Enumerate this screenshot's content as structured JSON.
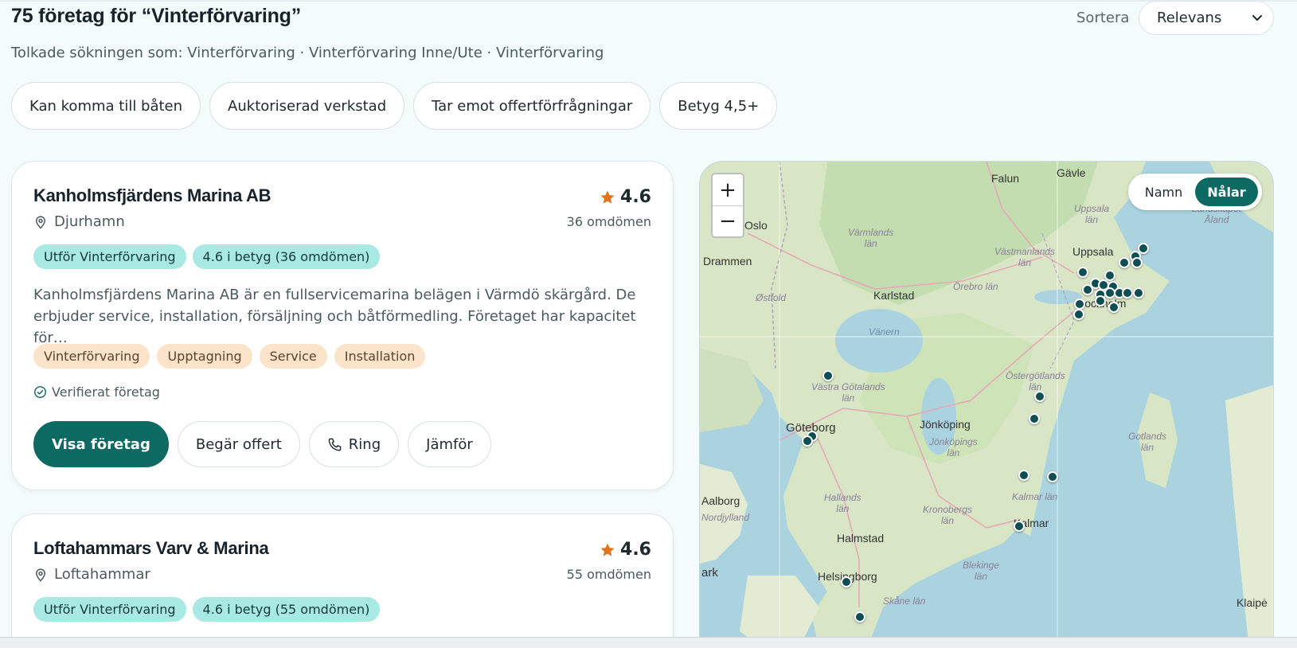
{
  "header": {
    "results_title": "75 företag för “Vinterförvaring”",
    "interpreted_text": "Tolkade sökningen som: Vinterförvaring · Vinterförvaring Inne/Ute · Vinterförvaring",
    "sort_label": "Sortera",
    "sort_value": "Relevans"
  },
  "filters": [
    "Kan komma till båten",
    "Auktoriserad verkstad",
    "Tar emot offertförfrågningar",
    "Betyg 4,5+"
  ],
  "listings": [
    {
      "name": "Kanholmsfjärdens Marina AB",
      "location": "Djurhamn",
      "rating": "4.6",
      "reviews": "36 omdömen",
      "badges": [
        "Utför Vinterförvaring",
        "4.6 i betyg (36 omdömen)"
      ],
      "description": "Kanholmsfjärdens Marina AB är en fullservicemarina belägen i Värmdö skärgård. De erbjuder service, installation, försäljning och båtförmedling. Företaget har kapacitet för…",
      "tags": [
        "Vinterförvaring",
        "Upptagning",
        "Service",
        "Installation"
      ],
      "verified": "Verifierat företag",
      "actions": [
        "Visa företag",
        "Begär offert",
        "Ring",
        "Jämför"
      ]
    },
    {
      "name": "Loftahammars Varv & Marina",
      "location": "Loftahammar",
      "rating": "4.6",
      "reviews": "55 omdömen",
      "badges": [
        "Utför Vinterförvaring",
        "4.6 i betyg (55 omdömen)"
      ]
    }
  ],
  "map": {
    "zoom_in": "+",
    "zoom_out": "−",
    "toggle": [
      "Namn",
      "Nålar"
    ],
    "toggle_active": "Nålar",
    "labels": {
      "oslo": "Oslo",
      "drammen": "Drammen",
      "ostfold": "Østfold",
      "falun": "Falun",
      "gavle": "Gävle",
      "varmlands": "Värmlands\nlän",
      "uppsala_lan": "Uppsala\nlän",
      "uppsala": "Uppsala",
      "vastmanlands": "Västmanlands\nlän",
      "karlstad": "Karlstad",
      "orebro": "Örebro län",
      "stockholm": "Stockholm",
      "vanern": "Vänern",
      "ostergotlands": "Östergötlands\nlän",
      "vastra": "Västra Götalands\nlän",
      "goteborg": "Göteborg",
      "jonkoping": "Jönköping",
      "jonkopings_lan": "Jönköpings\nlän",
      "gotlands": "Gotlands\nlän",
      "aalborg": "Aalborg",
      "nordjylland": "Nordjylland",
      "hallands": "Hallands\nlän",
      "kronobergs": "Kronobergs\nlän",
      "kalmar_lan": "Kalmar län",
      "kalmar": "Kalmar",
      "halmstad": "Halmstad",
      "blekinge": "Blekinge\nlän",
      "ark": "ark",
      "helsingborg": "Helsingborg",
      "skane": "Skåne län",
      "klaipe": "Klaipė",
      "landskapet": "Landskapet\nÅland"
    }
  },
  "colors": {
    "primary": "#0c6a63",
    "badge_teal": "#a9e9e4",
    "tag_peach": "#fbe4c9",
    "star": "#e0731b",
    "pin": "#0d4e52"
  }
}
